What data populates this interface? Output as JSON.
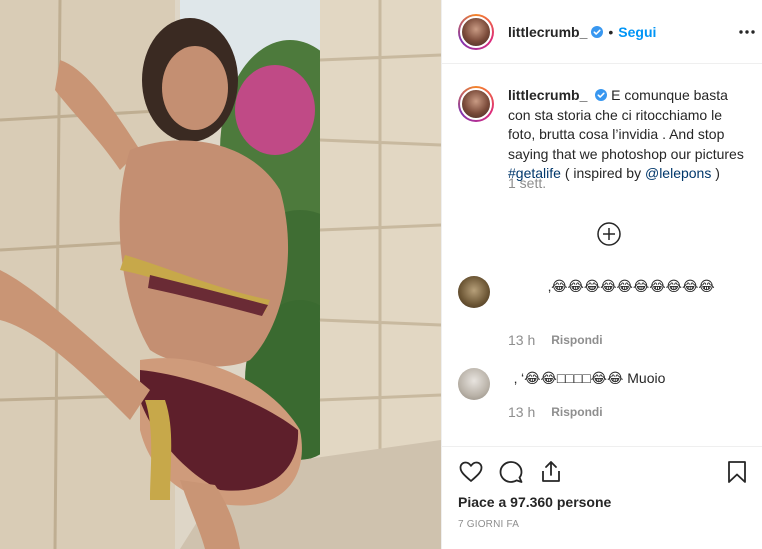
{
  "header": {
    "username": "littlecrumb_",
    "separator": "•",
    "follow_label": "Segui"
  },
  "caption": {
    "username": "littlecrumb_",
    "text": "E comunque basta con sta storia che ci ritocchiamo le foto, brutta cosa l’invidia . And stop saying that we photoshop our pictures",
    "hashtag": "#getalife",
    "inspired_prefix": "( inspired by",
    "mention": "@lelepons",
    "inspired_suffix": ")",
    "time": "1 sett."
  },
  "comments": [
    {
      "text": "‚😂😂😂😂😂😂😂😂😂😂",
      "time": "13 h",
      "reply_label": "Rispondi"
    },
    {
      "text": "‚   ‘😂😂□□□□😂😂 Muoio",
      "time": "13 h",
      "reply_label": "Rispondi"
    }
  ],
  "actions": {
    "likes": "Piace a 97.360 persone",
    "date": "7 GIORNI FA"
  },
  "colors": {
    "accent": "#0095f6",
    "verified": "#3897f0",
    "text": "#262626",
    "secondary": "#8e8e8e",
    "link": "#00376b",
    "border": "#efefef"
  },
  "icons": {
    "more": "more-horizontal-icon",
    "verified": "verified-badge-icon",
    "load_more": "plus-circle-icon",
    "like": "heart-icon",
    "comment": "comment-bubble-icon",
    "share": "share-upload-icon",
    "save": "bookmark-icon"
  }
}
